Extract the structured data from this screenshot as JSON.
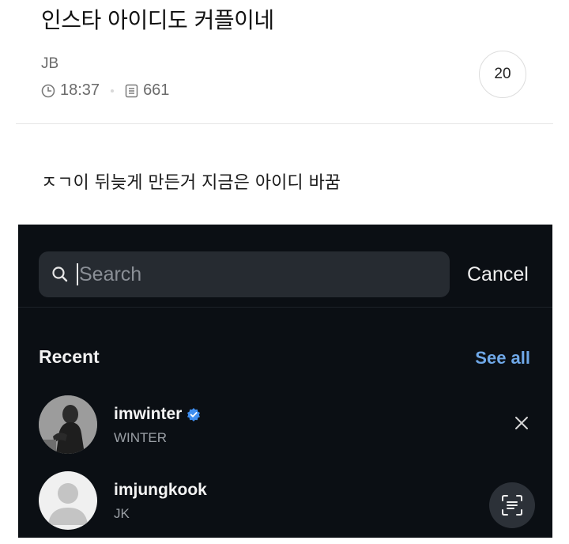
{
  "post": {
    "title": "인스타 아이디도 커플이네",
    "author": "JB",
    "time": "18:37",
    "views": "661",
    "comment_count": "20",
    "body": "ㅈㄱ이 뒤늦게 만든거 지금은 아이디 바꿈"
  },
  "screenshot": {
    "search": {
      "value": "Search",
      "cancel_label": "Cancel"
    },
    "recent": {
      "heading": "Recent",
      "see_all_label": "See all",
      "items": [
        {
          "username": "imwinter",
          "full_name": "WINTER",
          "verified": true
        },
        {
          "username": "imjungkook",
          "full_name": "JK",
          "verified": false
        }
      ]
    },
    "colors": {
      "background": "#0b0f14",
      "search_field": "#262b31",
      "link_blue": "#6fa8e8",
      "verified_blue": "#3f8ef0"
    }
  },
  "icons": {
    "time": "clock-icon",
    "views": "document-icon",
    "search": "magnifier-icon",
    "verified": "verified-badge-icon",
    "remove": "close-icon",
    "scan": "text-scan-icon"
  }
}
